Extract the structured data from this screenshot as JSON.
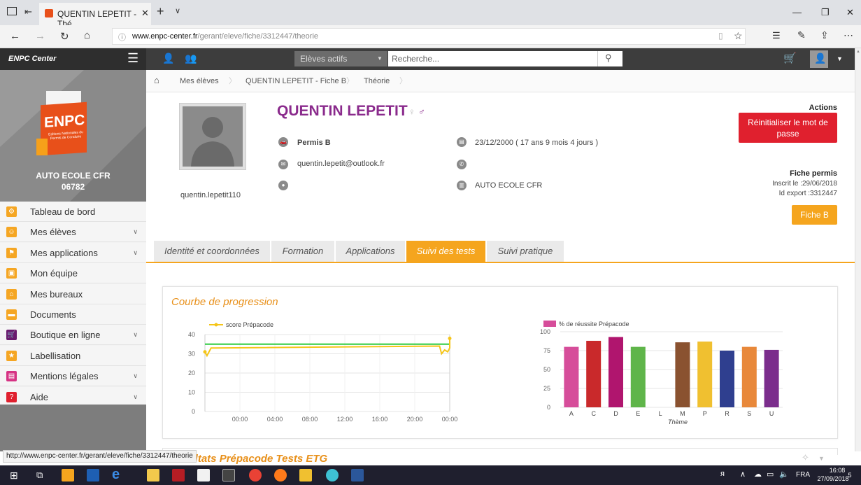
{
  "browser": {
    "tab_title": "QUENTIN LEPETIT - Thé",
    "url_host": "www.enpc-center.fr",
    "url_path": "/gerant/eleve/fiche/3312447/theorie",
    "status_url": "http://www.enpc-center.fr/gerant/eleve/fiche/3312447/theorie"
  },
  "topnav": {
    "brand": "ENPC Center",
    "filter_select": "Elèves actifs",
    "search_placeholder": "Recherche..."
  },
  "sidebar": {
    "school_name": "AUTO ECOLE CFR",
    "school_code": "06782",
    "logo_text": "ENPC",
    "logo_sub": "Editions Nationales du Permis de Conduire",
    "items": [
      {
        "label": "Tableau de bord",
        "color": "#f5a623",
        "has_chevron": false
      },
      {
        "label": "Mes élèves",
        "color": "#f5a623",
        "has_chevron": true
      },
      {
        "label": "Mes applications",
        "color": "#f5a623",
        "has_chevron": true
      },
      {
        "label": "Mon équipe",
        "color": "#f5a623",
        "has_chevron": false
      },
      {
        "label": "Mes bureaux",
        "color": "#f5a623",
        "has_chevron": false
      },
      {
        "label": "Documents",
        "color": "#f5a623",
        "has_chevron": false
      },
      {
        "label": "Boutique en ligne",
        "color": "#6a1a6e",
        "has_chevron": true
      },
      {
        "label": "Labellisation",
        "color": "#f5a623",
        "has_chevron": false
      },
      {
        "label": "Mentions légales",
        "color": "#d63384",
        "has_chevron": true
      },
      {
        "label": "Aide",
        "color": "#e0202e",
        "has_chevron": true
      }
    ]
  },
  "breadcrumb": [
    "Mes élèves",
    "QUENTIN LEPETIT - Fiche B",
    "Théorie"
  ],
  "student": {
    "name": "QUENTIN LEPETIT",
    "username": "quentin.lepetit110",
    "permis": "Permis B",
    "email": "quentin.lepetit@outlook.fr",
    "birth": "23/12/2000 ( 17 ans 9 mois 4 jours )",
    "school": "AUTO ECOLE CFR"
  },
  "actions": {
    "title": "Actions",
    "reset_button": "Réinitialiser le mot de passe",
    "fiche_title": "Fiche permis",
    "inscrit": "Inscrit le :29/06/2018",
    "id_export": "Id export :3312447",
    "fiche_button": "Fiche B"
  },
  "tabs": [
    {
      "label": "Identité et coordonnées",
      "active": false
    },
    {
      "label": "Formation",
      "active": false
    },
    {
      "label": "Applications",
      "active": false
    },
    {
      "label": "Suivi des tests",
      "active": true
    },
    {
      "label": "Suivi pratique",
      "active": false
    }
  ],
  "panel_title": "Courbe de progression",
  "results_title": "Résultats Prépacode Tests ETG",
  "chart_data": [
    {
      "type": "line",
      "legend": [
        "score Prépacode"
      ],
      "x_ticks": [
        "00:00",
        "04:00",
        "08:00",
        "12:00",
        "16:00",
        "20:00",
        "00:00"
      ],
      "y_ticks": [
        0,
        10,
        20,
        30,
        40
      ],
      "ylim": [
        0,
        40
      ],
      "series": [
        {
          "name": "score Prépacode",
          "color": "#f5c518",
          "x": [
            0,
            0.2,
            0.6,
            1.0,
            23.0,
            23.2,
            23.5,
            23.8,
            24.0,
            24.1
          ],
          "y": [
            31,
            29,
            33,
            33,
            34,
            30,
            32,
            31,
            33,
            38
          ]
        },
        {
          "color": "#2ecc40",
          "x": [
            0,
            24.1
          ],
          "y": [
            35,
            35
          ]
        }
      ],
      "grid": true,
      "legend_position": "top-left"
    },
    {
      "type": "bar",
      "legend": [
        "% de réussite Prépacode"
      ],
      "xlabel": "Thème",
      "categories": [
        "A",
        "C",
        "D",
        "E",
        "L",
        "M",
        "P",
        "R",
        "S",
        "U"
      ],
      "values": [
        80,
        88,
        93,
        80,
        0,
        86,
        87,
        75,
        80,
        76
      ],
      "colors": [
        "#d64d9a",
        "#c9292b",
        "#b0156e",
        "#5fb54a",
        "#888888",
        "#8a5230",
        "#f0c030",
        "#2f3f8f",
        "#e8883a",
        "#7b2d8c"
      ],
      "y_ticks": [
        0,
        25,
        50,
        75,
        100
      ],
      "ylim": [
        0,
        100
      ],
      "grid": true,
      "legend_position": "top-left"
    }
  ],
  "taskbar": {
    "lang": "FRA",
    "time": "16:08",
    "date": "27/09/2018",
    "notif": "5"
  }
}
